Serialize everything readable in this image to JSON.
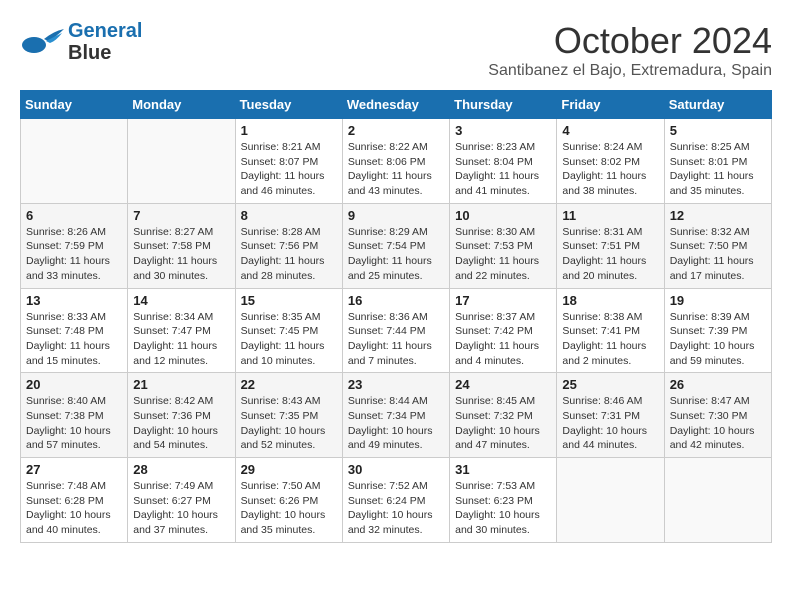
{
  "header": {
    "logo_line1": "General",
    "logo_line2": "Blue",
    "month": "October 2024",
    "location": "Santibanez el Bajo, Extremadura, Spain"
  },
  "days_of_week": [
    "Sunday",
    "Monday",
    "Tuesday",
    "Wednesday",
    "Thursday",
    "Friday",
    "Saturday"
  ],
  "weeks": [
    [
      {
        "day": "",
        "info": ""
      },
      {
        "day": "",
        "info": ""
      },
      {
        "day": "1",
        "info": "Sunrise: 8:21 AM\nSunset: 8:07 PM\nDaylight: 11 hours and 46 minutes."
      },
      {
        "day": "2",
        "info": "Sunrise: 8:22 AM\nSunset: 8:06 PM\nDaylight: 11 hours and 43 minutes."
      },
      {
        "day": "3",
        "info": "Sunrise: 8:23 AM\nSunset: 8:04 PM\nDaylight: 11 hours and 41 minutes."
      },
      {
        "day": "4",
        "info": "Sunrise: 8:24 AM\nSunset: 8:02 PM\nDaylight: 11 hours and 38 minutes."
      },
      {
        "day": "5",
        "info": "Sunrise: 8:25 AM\nSunset: 8:01 PM\nDaylight: 11 hours and 35 minutes."
      }
    ],
    [
      {
        "day": "6",
        "info": "Sunrise: 8:26 AM\nSunset: 7:59 PM\nDaylight: 11 hours and 33 minutes."
      },
      {
        "day": "7",
        "info": "Sunrise: 8:27 AM\nSunset: 7:58 PM\nDaylight: 11 hours and 30 minutes."
      },
      {
        "day": "8",
        "info": "Sunrise: 8:28 AM\nSunset: 7:56 PM\nDaylight: 11 hours and 28 minutes."
      },
      {
        "day": "9",
        "info": "Sunrise: 8:29 AM\nSunset: 7:54 PM\nDaylight: 11 hours and 25 minutes."
      },
      {
        "day": "10",
        "info": "Sunrise: 8:30 AM\nSunset: 7:53 PM\nDaylight: 11 hours and 22 minutes."
      },
      {
        "day": "11",
        "info": "Sunrise: 8:31 AM\nSunset: 7:51 PM\nDaylight: 11 hours and 20 minutes."
      },
      {
        "day": "12",
        "info": "Sunrise: 8:32 AM\nSunset: 7:50 PM\nDaylight: 11 hours and 17 minutes."
      }
    ],
    [
      {
        "day": "13",
        "info": "Sunrise: 8:33 AM\nSunset: 7:48 PM\nDaylight: 11 hours and 15 minutes."
      },
      {
        "day": "14",
        "info": "Sunrise: 8:34 AM\nSunset: 7:47 PM\nDaylight: 11 hours and 12 minutes."
      },
      {
        "day": "15",
        "info": "Sunrise: 8:35 AM\nSunset: 7:45 PM\nDaylight: 11 hours and 10 minutes."
      },
      {
        "day": "16",
        "info": "Sunrise: 8:36 AM\nSunset: 7:44 PM\nDaylight: 11 hours and 7 minutes."
      },
      {
        "day": "17",
        "info": "Sunrise: 8:37 AM\nSunset: 7:42 PM\nDaylight: 11 hours and 4 minutes."
      },
      {
        "day": "18",
        "info": "Sunrise: 8:38 AM\nSunset: 7:41 PM\nDaylight: 11 hours and 2 minutes."
      },
      {
        "day": "19",
        "info": "Sunrise: 8:39 AM\nSunset: 7:39 PM\nDaylight: 10 hours and 59 minutes."
      }
    ],
    [
      {
        "day": "20",
        "info": "Sunrise: 8:40 AM\nSunset: 7:38 PM\nDaylight: 10 hours and 57 minutes."
      },
      {
        "day": "21",
        "info": "Sunrise: 8:42 AM\nSunset: 7:36 PM\nDaylight: 10 hours and 54 minutes."
      },
      {
        "day": "22",
        "info": "Sunrise: 8:43 AM\nSunset: 7:35 PM\nDaylight: 10 hours and 52 minutes."
      },
      {
        "day": "23",
        "info": "Sunrise: 8:44 AM\nSunset: 7:34 PM\nDaylight: 10 hours and 49 minutes."
      },
      {
        "day": "24",
        "info": "Sunrise: 8:45 AM\nSunset: 7:32 PM\nDaylight: 10 hours and 47 minutes."
      },
      {
        "day": "25",
        "info": "Sunrise: 8:46 AM\nSunset: 7:31 PM\nDaylight: 10 hours and 44 minutes."
      },
      {
        "day": "26",
        "info": "Sunrise: 8:47 AM\nSunset: 7:30 PM\nDaylight: 10 hours and 42 minutes."
      }
    ],
    [
      {
        "day": "27",
        "info": "Sunrise: 7:48 AM\nSunset: 6:28 PM\nDaylight: 10 hours and 40 minutes."
      },
      {
        "day": "28",
        "info": "Sunrise: 7:49 AM\nSunset: 6:27 PM\nDaylight: 10 hours and 37 minutes."
      },
      {
        "day": "29",
        "info": "Sunrise: 7:50 AM\nSunset: 6:26 PM\nDaylight: 10 hours and 35 minutes."
      },
      {
        "day": "30",
        "info": "Sunrise: 7:52 AM\nSunset: 6:24 PM\nDaylight: 10 hours and 32 minutes."
      },
      {
        "day": "31",
        "info": "Sunrise: 7:53 AM\nSunset: 6:23 PM\nDaylight: 10 hours and 30 minutes."
      },
      {
        "day": "",
        "info": ""
      },
      {
        "day": "",
        "info": ""
      }
    ]
  ]
}
